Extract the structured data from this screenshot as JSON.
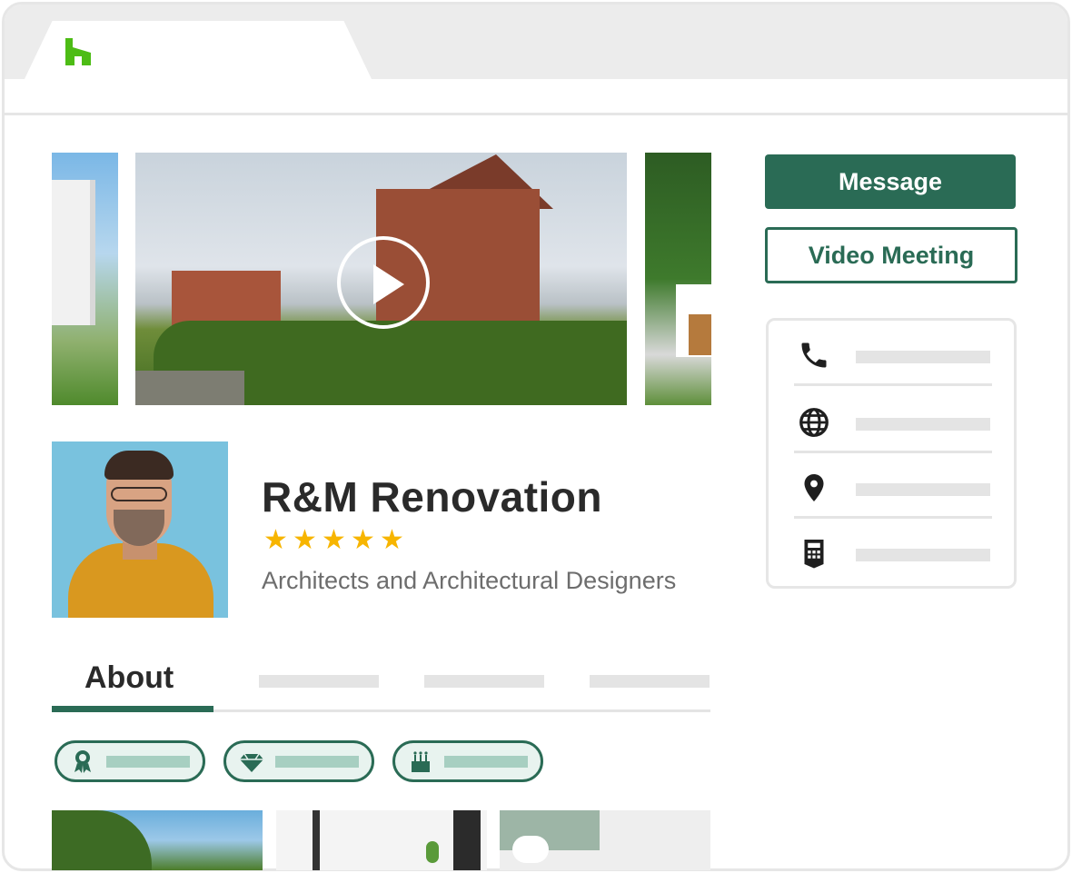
{
  "browser": {
    "tab_logo": "houzz-logo",
    "brand_color": "#4dbc15"
  },
  "gallery": {
    "play_icon": "play-icon"
  },
  "profile": {
    "business_name": "R&M Renovation",
    "rating": 5,
    "rating_max": 5,
    "stars": [
      "★",
      "★",
      "★",
      "★",
      "★"
    ],
    "category": "Architects and Architectural Designers"
  },
  "tabs": {
    "active_label": "About"
  },
  "chips": [
    {
      "icon": "award-icon",
      "glyph": "🏅"
    },
    {
      "icon": "diamond-icon",
      "glyph": "◆"
    },
    {
      "icon": "cake-icon",
      "glyph": "🎂"
    }
  ],
  "actions": {
    "message_label": "Message",
    "video_label": "Video Meeting"
  },
  "contact": {
    "items": [
      {
        "icon": "phone-icon"
      },
      {
        "icon": "globe-icon"
      },
      {
        "icon": "location-pin-icon"
      },
      {
        "icon": "calculator-icon"
      }
    ]
  },
  "colors": {
    "accent": "#2a6b55",
    "chip_fill": "#e8f3ef",
    "star": "#f7b500"
  }
}
